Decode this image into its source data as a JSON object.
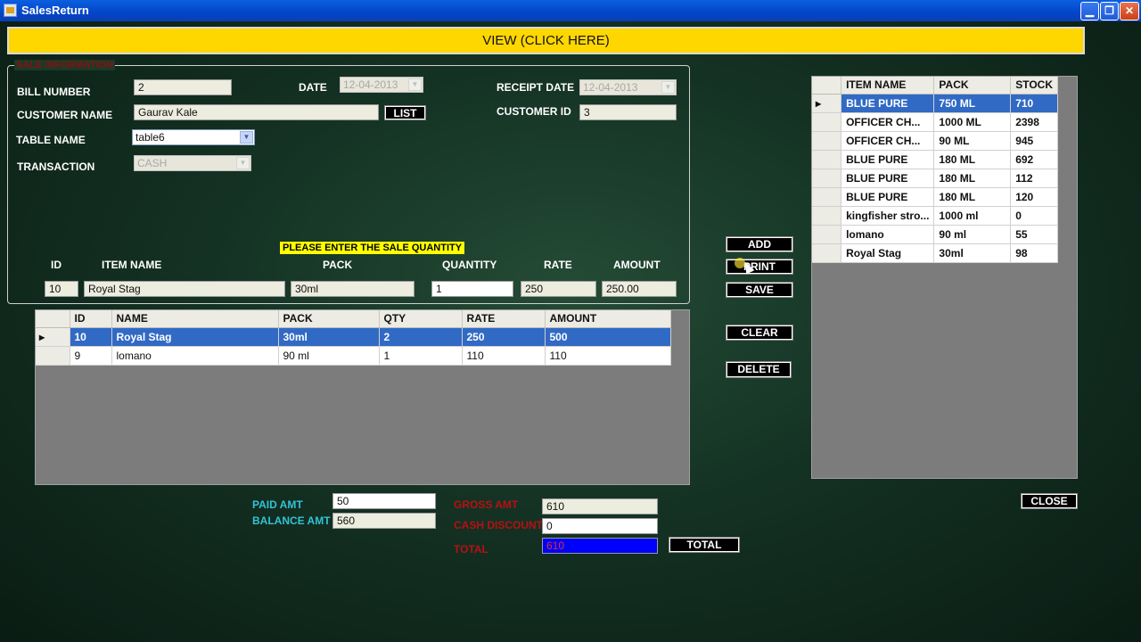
{
  "window": {
    "title": "SalesReturn",
    "controls": {
      "minimize": "▁",
      "restore": "❐",
      "close": "✕"
    }
  },
  "view_banner": "VIEW (CLICK HERE)",
  "sale_info": {
    "legend": "SALE INFORMATION",
    "bill_number_label": "BILL NUMBER",
    "bill_number": "2",
    "date_label": "DATE",
    "date": "12-04-2013",
    "receipt_date_label": "RECEIPT DATE",
    "receipt_date": "12-04-2013",
    "customer_name_label": "CUSTOMER NAME",
    "customer_name": "Gaurav Kale",
    "list_button": "LIST",
    "customer_id_label": "CUSTOMER ID",
    "customer_id": "3",
    "table_name_label": "TABLE NAME",
    "table_name": "table6",
    "transaction_label": "TRANSACTION",
    "transaction": "CASH",
    "prompt": "PLEASE  ENTER THE SALE QUANTITY",
    "entry_headers": {
      "id": "ID",
      "item_name": "ITEM NAME",
      "pack": "PACK",
      "quantity": "QUANTITY",
      "rate": "RATE",
      "amount": "AMOUNT"
    },
    "entry": {
      "id": "10",
      "item_name": "Royal Stag",
      "pack": "30ml",
      "quantity": "1",
      "rate": "250",
      "amount": "250.00"
    }
  },
  "sale_grid": {
    "columns": [
      "ID",
      "NAME",
      "PACK",
      "QTY",
      "RATE",
      "AMOUNT"
    ],
    "row_marker": "▸",
    "rows": [
      [
        "10",
        "Royal Stag",
        "30ml",
        "2",
        "250",
        "500"
      ],
      [
        "9",
        "lomano",
        "90 ml",
        "1",
        "110",
        "110"
      ]
    ]
  },
  "actions": {
    "add": "ADD",
    "print": "PRINT",
    "save": "SAVE",
    "clear": "CLEAR",
    "delete": "DELETE",
    "close": "CLOSE",
    "total": "TOTAL"
  },
  "stock_grid": {
    "columns": [
      "ITEM NAME",
      "PACK",
      "STOCK"
    ],
    "row_marker": "▸",
    "rows": [
      [
        "BLUE PURE",
        "750 ML",
        "710"
      ],
      [
        "OFFICER CH...",
        "1000 ML",
        "2398"
      ],
      [
        "OFFICER CH...",
        "90 ML",
        "945"
      ],
      [
        "BLUE PURE",
        "180 ML",
        "692"
      ],
      [
        "BLUE PURE",
        "180 ML",
        "112"
      ],
      [
        "BLUE PURE",
        "180 ML",
        "120"
      ],
      [
        "kingfisher stro...",
        "1000 ml",
        "0"
      ],
      [
        "lomano",
        "90 ml",
        "55"
      ],
      [
        "Royal Stag",
        "30ml",
        "98"
      ]
    ]
  },
  "payment": {
    "paid_amt_label": "PAID AMT",
    "paid_amt": "50",
    "balance_amt_label": "BALANCE AMT",
    "balance_amt": "560",
    "gross_amt_label": "GROSS AMT",
    "gross_amt": "610",
    "cash_discount_label": "CASH DISCOUNT",
    "cash_discount": "0",
    "total_label": "TOTAL",
    "total": "610"
  }
}
